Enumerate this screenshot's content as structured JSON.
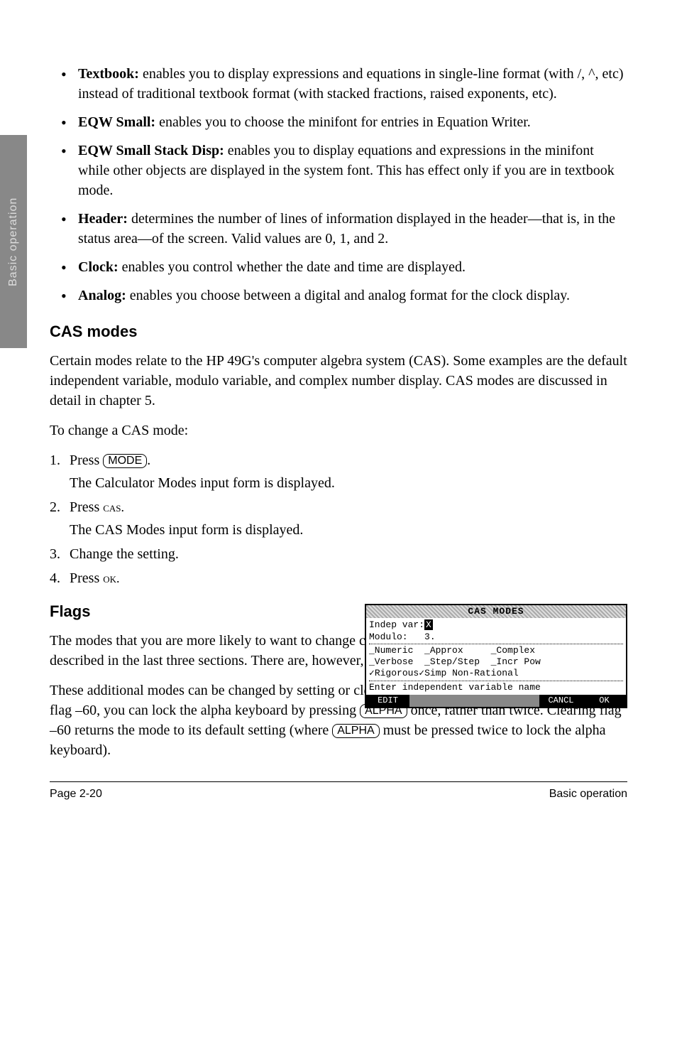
{
  "sideTab": "Basic operation",
  "bullets": [
    {
      "term": "Textbook:",
      "text": " enables you to display expressions and equations in single-line format (with /, ^, etc) instead of traditional textbook format (with stacked fractions, raised exponents, etc)."
    },
    {
      "term": "EQW Small:",
      "text": " enables you to choose the minifont for entries in Equation Writer."
    },
    {
      "term": "EQW Small Stack Disp:",
      "text": " enables you to display equations and expressions in the minifont while other objects are displayed in the system font. This has effect only if you are in textbook mode."
    },
    {
      "term": "Header:",
      "text": " determines the number of lines of information displayed in the header—that is, in the status area—of the screen. Valid values are 0, 1, and 2."
    },
    {
      "term": "Clock:",
      "text": " enables you control whether the date and time are displayed."
    },
    {
      "term": "Analog:",
      "text": " enables you choose between a digital and analog format for the clock display."
    }
  ],
  "h_casmodes": "CAS modes",
  "p_cas1": "Certain modes relate to the HP 49G's computer algebra system (CAS). Some examples are the default independent variable, modulo variable, and complex number display. CAS modes are discussed in detail in chapter 5.",
  "p_cas2": "To change a CAS mode:",
  "steps": {
    "s1_pre": "Press ",
    "s1_key": "MODE",
    "s1_post": ".",
    "s1_sub": "The Calculator Modes input form is displayed.",
    "s2_pre": "Press ",
    "s2_sc": "cas.",
    "s2_sub": "The CAS Modes input form is displayed.",
    "s3": "Change the setting.",
    "s4_pre": "Press ",
    "s4_sc": "ok."
  },
  "h_flags": "Flags",
  "p_flags1": "The modes that you are more likely to want to change can be changed easily using the input forms described in the last three sections. There are, however, many more modes that you can change.",
  "p_flags2_pre": "These additional modes can be changed by setting or clearing certain flags. For example, by setting flag –60, you can lock the alpha keyboard by pressing ",
  "p_flags2_key1": "ALPHA",
  "p_flags2_mid": " once, rather than twice. Clearing flag –60 returns the mode to its default setting (where ",
  "p_flags2_key2": "ALPHA",
  "p_flags2_post": " must be pressed twice to lock the alpha keyboard).",
  "calc": {
    "title": "CAS MODES",
    "r1a": "Indep var:",
    "r1b": "X",
    "r2": "Modulo:   3.",
    "r3": "_Numeric  _Approx     _Complex",
    "r4": "_Verbose  _Step/Step  _Incr Pow",
    "r5": "✓Rigorous✓Simp Non-Rational",
    "r6": "Enter independent variable name",
    "sk": [
      "EDIT",
      "",
      "",
      "",
      "CANCL",
      "OK"
    ]
  },
  "footer": {
    "left": "Page 2-20",
    "right": "Basic operation"
  }
}
